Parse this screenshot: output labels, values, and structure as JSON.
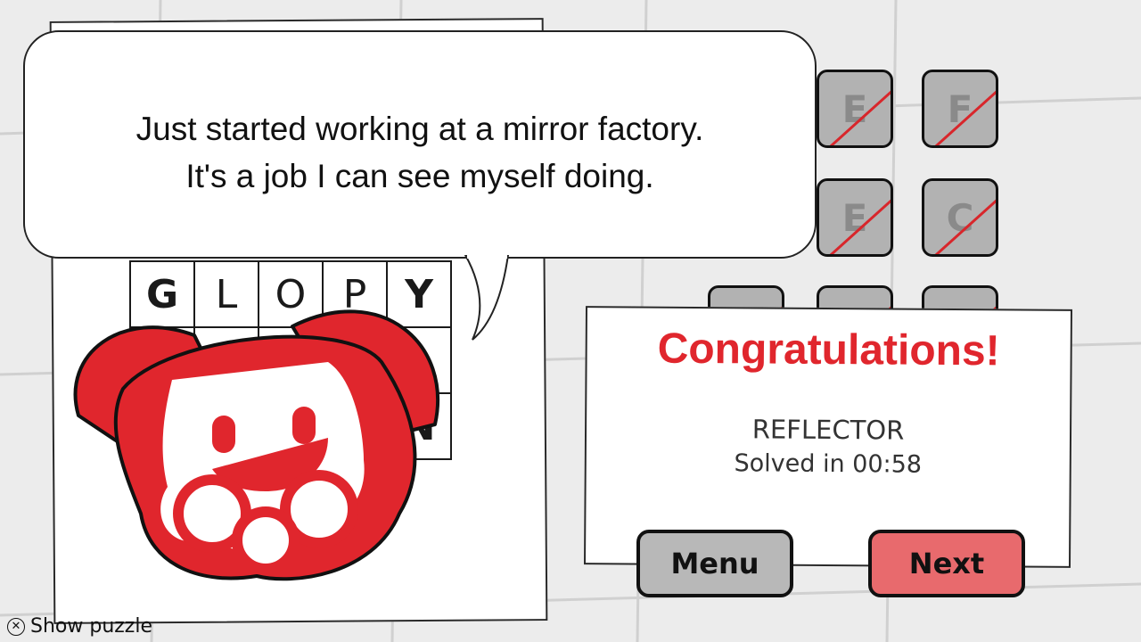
{
  "speech": {
    "line1": "Just started working at a mirror factory.",
    "line2": "It's a job I can see myself doing."
  },
  "crossword": {
    "row1": [
      "G",
      "L",
      "O",
      "P",
      "Y"
    ],
    "row_partial": [
      "",
      "",
      "",
      "",
      "N"
    ]
  },
  "tiles": [
    {
      "letter": "E"
    },
    {
      "letter": "F"
    },
    {
      "letter": "E"
    },
    {
      "letter": "C"
    },
    {
      "letter": ""
    },
    {
      "letter": ""
    },
    {
      "letter": ""
    }
  ],
  "result": {
    "title": "Congratulations!",
    "word": "REFLECTOR",
    "time": "Solved in 00:58"
  },
  "buttons": {
    "menu": "Menu",
    "next": "Next"
  },
  "hint": {
    "icon": "x-button-icon",
    "label": "Show puzzle"
  },
  "colors": {
    "accent_red": "#e0262d",
    "next_button": "#e86a6d",
    "menu_button": "#b8b8b8",
    "tile_gray": "#b2b2b2"
  }
}
